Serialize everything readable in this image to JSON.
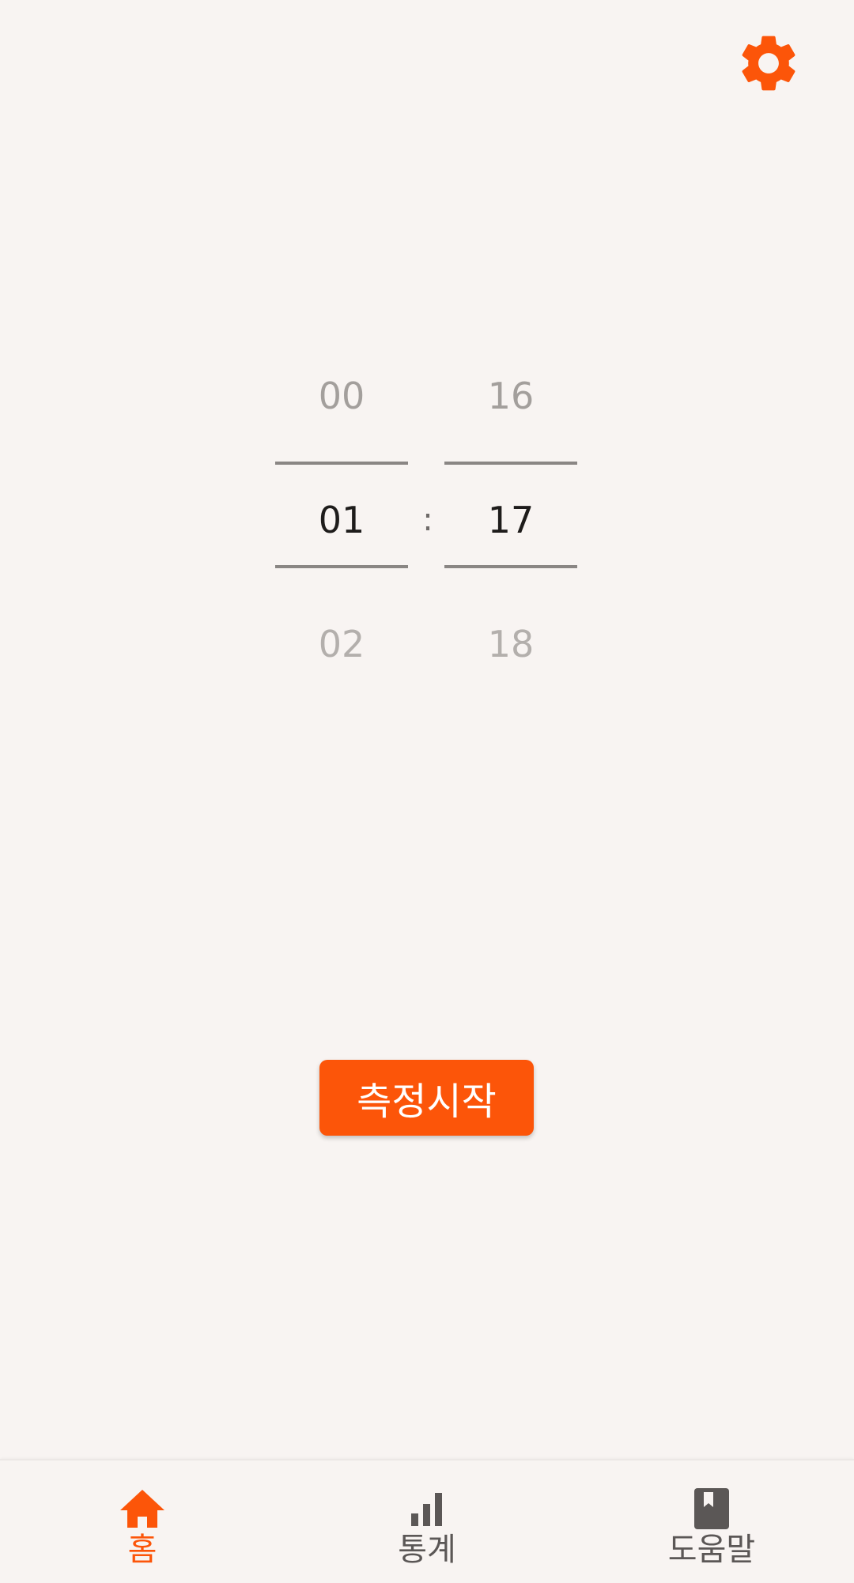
{
  "settings": {
    "icon": "gear-icon",
    "color": "#fc5509"
  },
  "picker": {
    "hours": {
      "prev": "00",
      "current": "01",
      "next": "02"
    },
    "separator": ":",
    "minutes": {
      "prev": "16",
      "current": "17",
      "next": "18"
    }
  },
  "start_button": {
    "label": "측정시작",
    "color": "#fc5509"
  },
  "bottom_nav": {
    "active_color": "#fc5509",
    "inactive_color": "#5b5756",
    "items": [
      {
        "label": "홈",
        "icon": "home-icon",
        "active": true
      },
      {
        "label": "통계",
        "icon": "bar-chart-icon",
        "active": false
      },
      {
        "label": "도움말",
        "icon": "book-icon",
        "active": false
      }
    ]
  }
}
